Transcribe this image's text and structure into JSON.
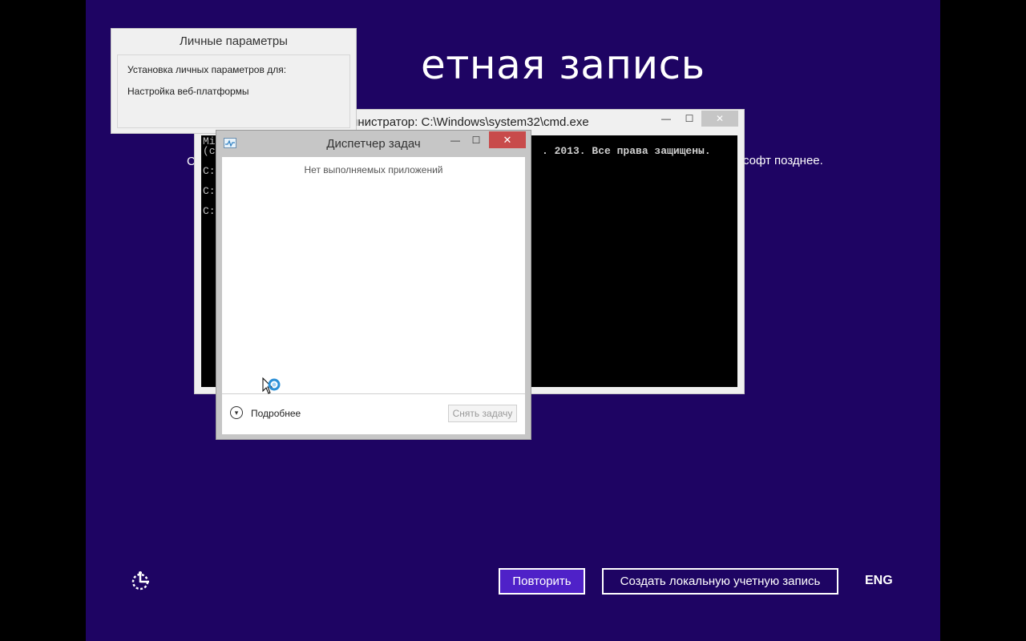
{
  "oobe": {
    "title_partial": "етная запись",
    "text_left_partial": "С",
    "text_right_partial": "софт позднее."
  },
  "cmd": {
    "title_partial": "инистратор: C:\\Windows\\system32\\cmd.exe",
    "lines": [
      "Mi",
      "(c",
      "",
      "C:",
      "",
      "C:",
      "",
      "C:"
    ],
    "copyright_partial": ". 2013. Все права защищены.",
    "min_glyph": "—",
    "max_glyph": "☐",
    "close_glyph": "✕"
  },
  "personal_settings": {
    "title": "Личные параметры",
    "line1": "Установка личных параметров для:",
    "line2": "Настройка веб-платформы"
  },
  "task_manager": {
    "title": "Диспетчер задач",
    "empty_message": "Нет выполняемых приложений",
    "more_details": "Подробнее",
    "end_task": "Снять задачу",
    "min_glyph": "—",
    "max_glyph": "☐",
    "close_glyph": "✕",
    "more_icon_glyph": "▾"
  },
  "footer": {
    "retry_label": "Повторить",
    "local_account_label": "Создать локальную учетную запись",
    "language": "ENG"
  },
  "colors": {
    "background": "#1e0463",
    "accent_button": "#4f21c8",
    "close_red": "#c84b4b"
  }
}
